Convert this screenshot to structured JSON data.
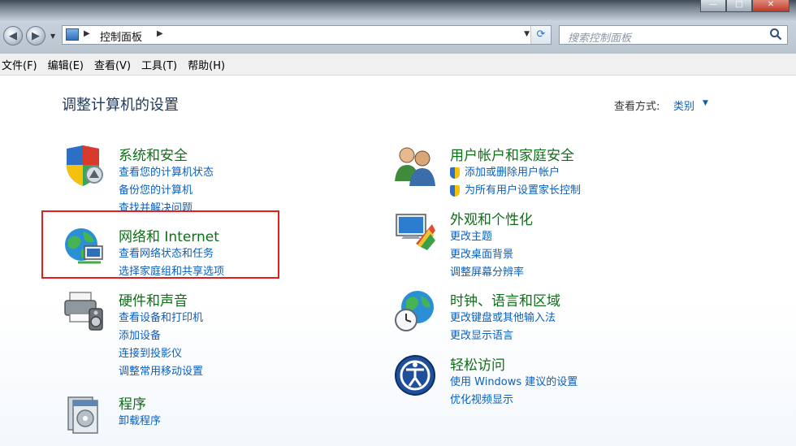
{
  "window": {
    "controls": [
      "—",
      "□",
      "✕"
    ]
  },
  "nav": {
    "back_glyph": "◀",
    "forward_glyph": "▶",
    "dropdown_glyph": "▼"
  },
  "address": {
    "path": "控制面板",
    "arrow_glyph": "▶",
    "dropdown_glyph": "▼",
    "refresh_glyph": "⟳"
  },
  "search": {
    "placeholder": "搜索控制面板"
  },
  "menu": [
    "文件(F)",
    "编辑(E)",
    "查看(V)",
    "工具(T)",
    "帮助(H)"
  ],
  "main": {
    "title": "调整计算机的设置",
    "view_by_label": "查看方式:",
    "view_by_value": "类别",
    "view_by_arrow": "▼"
  },
  "categories": [
    {
      "title": "系统和安全",
      "links": [
        "查看您的计算机状态",
        "备份您的计算机",
        "查找并解决问题"
      ]
    },
    {
      "title": "网络和 Internet",
      "links": [
        "查看网络状态和任务",
        "选择家庭组和共享选项"
      ]
    },
    {
      "title": "硬件和声音",
      "links": [
        "查看设备和打印机",
        "添加设备",
        "连接到投影仪",
        "调整常用移动设置"
      ]
    },
    {
      "title": "程序",
      "links": [
        "卸载程序"
      ]
    },
    {
      "title": "用户帐户和家庭安全",
      "links": [
        "添加或删除用户帐户",
        "为所有用户设置家长控制"
      ]
    },
    {
      "title": "外观和个性化",
      "links": [
        "更改主题",
        "更改桌面背景",
        "调整屏幕分辨率"
      ]
    },
    {
      "title": "时钟、语言和区域",
      "links": [
        "更改键盘或其他输入法",
        "更改显示语言"
      ]
    },
    {
      "title": "轻松访问",
      "links": [
        "使用 Windows 建议的设置",
        "优化视频显示"
      ]
    }
  ],
  "colors": {
    "link": "#0b5fbd",
    "category_title": "#0f6e18",
    "highlight_border": "#e02020"
  }
}
